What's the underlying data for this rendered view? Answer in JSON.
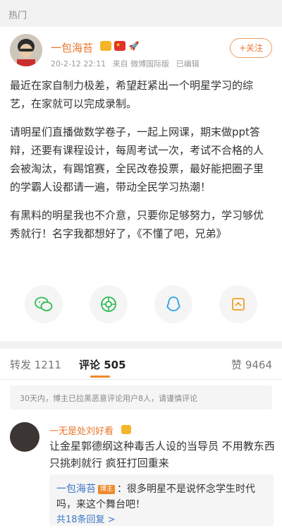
{
  "section": {
    "title": "热门"
  },
  "post": {
    "author": "一包海苔",
    "badges": [
      "crown-badge",
      "china-flag-badge",
      "rocket-badge"
    ],
    "timestamp": "20-2-12 22:11",
    "source": "来自 微博国际版",
    "edited": "已编辑",
    "follow_label": "+关注",
    "paragraphs": [
      "最近在家自制力极差，希望赶紧出一个明星学习的综艺，在家就可以完成录制。",
      "请明星们直播做数学卷子，一起上网课，期末做ppt答辩，还要有课程设计，每周考试一次，考试不合格的人会被淘汰，有踢馆赛，全民改卷投票，最好能把圈子里的学霸人设都请一遍，带动全民学习热潮！",
      "有黑料的明星我也不介意，只要你足够努力，学习够优秀就行！名字我都想好了，《不懂了吧，兄弟》"
    ]
  },
  "share": [
    "wechat-icon",
    "moments-icon",
    "qq-icon",
    "qzone-icon"
  ],
  "tabs": {
    "repost": "转发 1211",
    "comments": "评论 505",
    "likes": "赞 9464"
  },
  "notice": "30天内，博主已拉黑恶意评论用户8人，请谨慎评论",
  "comment": {
    "author": "一无是处刘好看",
    "text": "让金星郭德纲这种毒舌人设的当导员 不用教东西只挑刺就行 疯狂打回重来",
    "reply": {
      "author": "一包海苔",
      "tag": "博主",
      "text": "：很多明星不是说怀念学生时代吗，来这个舞台吧！",
      "more": "共18条回复 >"
    }
  },
  "colors": {
    "accent": "#e8762d",
    "link": "#3d77c6"
  }
}
